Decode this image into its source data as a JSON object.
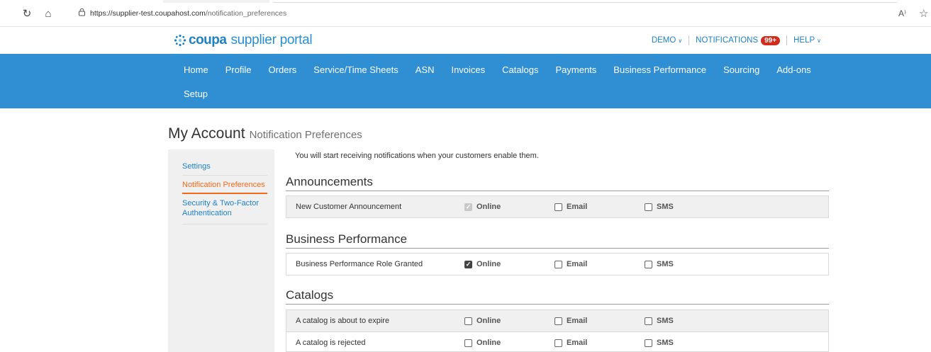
{
  "browser": {
    "url_host": "https://supplier-test.coupahost.com",
    "url_path": "/notification_preferences",
    "reader_label": "A⁾"
  },
  "portal": {
    "logo_brand": "coupa",
    "logo_suffix": "supplier portal",
    "top_links": {
      "demo": "DEMO",
      "notifications": "NOTIFICATIONS",
      "notifications_badge": "99+",
      "help": "HELP"
    }
  },
  "nav": {
    "row1": [
      "Home",
      "Profile",
      "Orders",
      "Service/Time Sheets",
      "ASN",
      "Invoices",
      "Catalogs",
      "Payments",
      "Business Performance",
      "Sourcing",
      "Add-ons"
    ],
    "row2": [
      "Setup"
    ]
  },
  "page": {
    "title": "My Account",
    "subtitle": "Notification Preferences"
  },
  "side_menu": {
    "items": [
      {
        "label": "Settings"
      },
      {
        "label": "Notification Preferences"
      },
      {
        "label": "Security & Two-Factor Authentication"
      }
    ]
  },
  "content": {
    "intro": "You will start receiving notifications when your customers enable them.",
    "option_labels": {
      "online": "Online",
      "email": "Email",
      "sms": "SMS"
    },
    "sections": [
      {
        "title": "Announcements",
        "rows": [
          {
            "label": "New Customer Announcement",
            "online": "disabled-checked",
            "email": false,
            "sms": false
          }
        ]
      },
      {
        "title": "Business Performance",
        "rows": [
          {
            "label": "Business Performance Role Granted",
            "online": "checked",
            "email": false,
            "sms": false
          }
        ]
      },
      {
        "title": "Catalogs",
        "rows": [
          {
            "label": "A catalog is about to expire",
            "online": false,
            "email": false,
            "sms": false
          },
          {
            "label": "A catalog is rejected",
            "online": false,
            "email": false,
            "sms": false
          }
        ]
      }
    ]
  },
  "colors": {
    "accent_blue": "#2f8fd2",
    "link_blue": "#1f81c5",
    "active_orange": "#f26b1d",
    "badge_red": "#d12d1f"
  }
}
